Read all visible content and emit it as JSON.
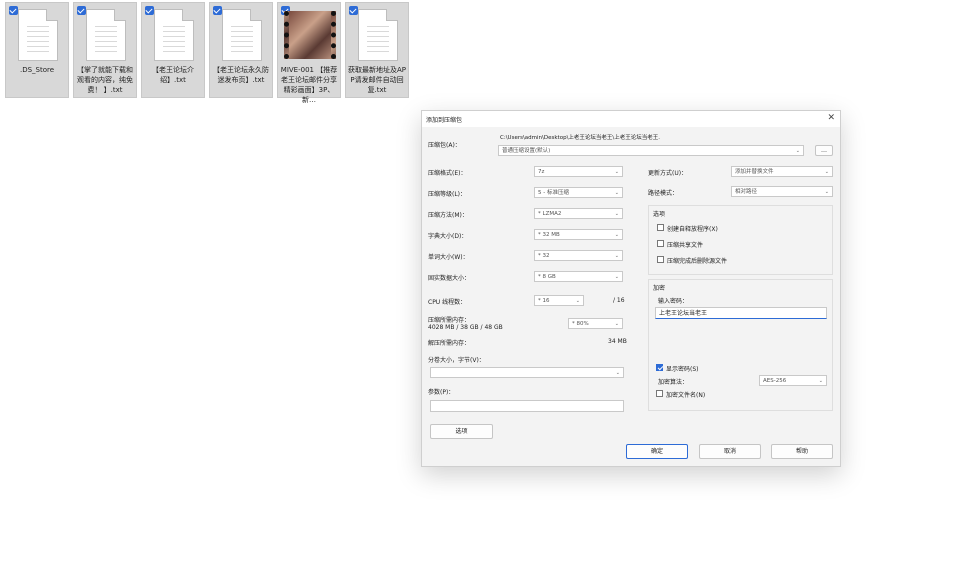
{
  "files": [
    {
      "name": ".DS_Store",
      "type": "doc"
    },
    {
      "name": "【掌了就能下载和观看的内容，纯免费！ 】.txt",
      "type": "doc"
    },
    {
      "name": "【老王论坛介绍】.txt",
      "type": "doc"
    },
    {
      "name": "【老王论坛永久防迷发布页】.txt",
      "type": "doc"
    },
    {
      "name": "MIVE-001 【推荐老王论坛邮件分享精彩画面】3P、新…",
      "type": "video"
    },
    {
      "name": "获取最新地址及APP请发邮件自动回复.txt",
      "type": "doc"
    }
  ],
  "dialog": {
    "title": "添加到压缩包",
    "close": "✕",
    "archive_label": "压缩包(A)：",
    "path_text": "C:\\Users\\admin\\Desktop\\上老王论坛当老王\\上老王论坛当老王.",
    "profile_value": "普通压缩设置(默认)",
    "browse_label": "…",
    "left": [
      {
        "label": "压缩格式(E)：",
        "value": "7z"
      },
      {
        "label": "压缩等级(L)：",
        "value": "5 - 标准压缩"
      },
      {
        "label": "压缩方法(M)：",
        "value": "* LZMA2"
      },
      {
        "label": "字典大小(D)：",
        "value": "* 32 MB"
      },
      {
        "label": "单词大小(W)：",
        "value": "* 32"
      },
      {
        "label": "固实数据大小：",
        "value": "* 8 GB"
      }
    ],
    "cpu_label": "CPU 线程数：",
    "cpu_value": "* 16",
    "cpu_total": "/ 16",
    "mem_label": "压缩所需内存：",
    "mem_detail": "4028 MB / 38 GB / 48 GB",
    "mem_percent": "* 80%",
    "decomp_label": "解压所需内存：",
    "decomp_value": "34 MB",
    "split_label": "分卷大小，字节(V)：",
    "params_label": "参数(P)：",
    "options_button": "选项",
    "right_update_label": "更新方式(U)：",
    "right_update_value": "添加并替换文件",
    "right_path_label": "路径模式：",
    "right_path_value": "相对路径",
    "options_title": "选项",
    "option_items": [
      "创建自释放程序(X)",
      "压缩共享文件",
      "压缩完成后删除源文件"
    ],
    "encrypt_title": "加密",
    "password_label": "输入密码：",
    "password_value": "上老王论坛当老王",
    "show_password": "显示密码(S)",
    "encrypt_method_label": "加密算法：",
    "encrypt_method_value": "AES-256",
    "encrypt_names": "加密文件名(N)",
    "ok": "确定",
    "cancel": "取消",
    "help": "帮助"
  }
}
